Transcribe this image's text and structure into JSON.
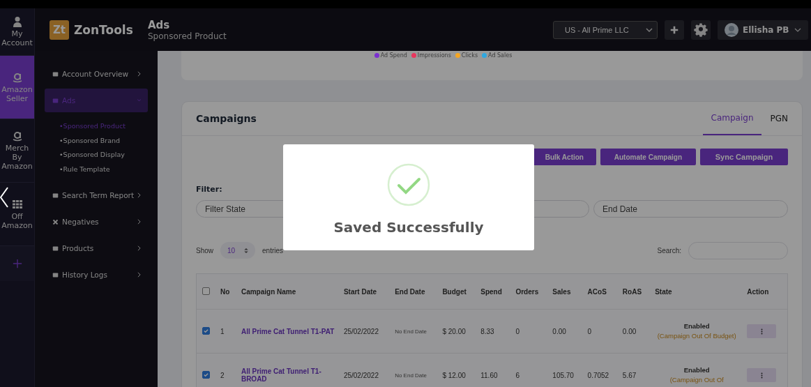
{
  "rail": [
    {
      "label": "My Account",
      "selected": false
    },
    {
      "label": "Amazon Seller",
      "selected": true
    },
    {
      "label": "Merch By Amazon",
      "selected": false
    },
    {
      "label": "Off Amazon",
      "selected": false
    }
  ],
  "header": {
    "brand_mark": "Zt",
    "brand": "ZonTools",
    "title": "Ads",
    "subtitle": "Sponsored Product",
    "account": "US - All Prime LLC",
    "user": "Ellisha PB"
  },
  "nav": [
    {
      "label": "Account Overview",
      "selected": false,
      "expanded": false
    },
    {
      "label": "Ads",
      "selected": true,
      "expanded": true,
      "children": [
        {
          "label": "•Sponsored Product",
          "selected": true
        },
        {
          "label": "•Sponsored Brand",
          "selected": false
        },
        {
          "label": "•Sponsored Display",
          "selected": false
        },
        {
          "label": "•Rule Template",
          "selected": false
        }
      ]
    },
    {
      "label": "Search Term Report",
      "selected": false,
      "expanded": false
    },
    {
      "label": "Negatives",
      "selected": false,
      "expanded": false
    },
    {
      "label": "Products",
      "selected": false,
      "expanded": false
    },
    {
      "label": "History Logs",
      "selected": false,
      "expanded": false
    }
  ],
  "chart_legend": [
    {
      "label": "Ad Spend",
      "color": "#7b2fd0"
    },
    {
      "label": "Impressions",
      "color": "#e8365d"
    },
    {
      "label": "Clicks",
      "color": "#f5a623"
    },
    {
      "label": "Ad Sales",
      "color": "#2fa8e0"
    }
  ],
  "campaigns": {
    "title": "Campaigns",
    "tabs": [
      {
        "label": "Campaign",
        "selected": true
      },
      {
        "label": "PGN",
        "selected": false
      }
    ],
    "buttons": [
      "Bulk Action",
      "Automate Campaign",
      "Sync Campaign"
    ],
    "filter_label": "Filter:",
    "filters": [
      {
        "placeholder": "Filter State"
      },
      {
        "placeholder": "End Date"
      }
    ],
    "show_label": "Show",
    "page_size": "10",
    "entries_label": "entries",
    "search_label": "Search:",
    "table": {
      "all_checked": false,
      "columns": [
        "No",
        "Campaign Name",
        "Start Date",
        "End Date",
        "Budget",
        "Spend",
        "Orders",
        "Sales",
        "ACoS",
        "RoAS",
        "State",
        "Action"
      ],
      "rows": [
        {
          "checked": true,
          "no": "1",
          "name": "All Prime Cat Tunnel T1-PAT",
          "start": "25/02/2022",
          "end": "No End Date",
          "budget": "$ 20.00",
          "spend": "8.33",
          "orders": "0",
          "sales": "0.00",
          "acos": "0",
          "roas": "0.00",
          "state": "Enabled",
          "state_note": "(Campaign Out Of Budget)"
        },
        {
          "checked": true,
          "no": "2",
          "name": "All Prime Cat Tunnel T1-BROAD",
          "start": "25/02/2022",
          "end": "No End Date",
          "budget": "$ 12.00",
          "spend": "11.60",
          "orders": "6",
          "sales": "105.70",
          "acos": "0.7052",
          "roas": "5.67",
          "state": "Enabled",
          "state_note": "(Campaign Out Of"
        }
      ]
    }
  },
  "modal": {
    "message": "Saved Successfully"
  }
}
